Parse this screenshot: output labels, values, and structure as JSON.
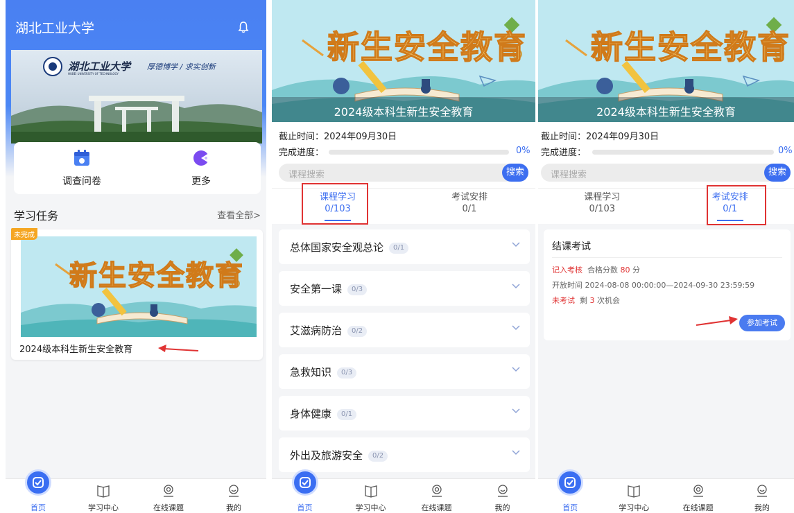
{
  "panel1": {
    "app_title": "湖北工业大学",
    "campus_motto": "厚德博学 / 求实创新",
    "campus_name": "湖北工业大学",
    "campus_name_en": "HUBEI UNIVERSITY OF TECHNOLOGY",
    "quick_actions": [
      {
        "label": "调查问卷",
        "icon": "calendar-icon"
      },
      {
        "label": "更多",
        "icon": "more-icon"
      }
    ],
    "section_title": "学习任务",
    "section_more": "查看全部>",
    "task": {
      "badge": "未完成",
      "banner_text": "新生安全教育",
      "name": "2024级本科生新生安全教育"
    }
  },
  "course_panel": {
    "banner_text": "新生安全教育",
    "banner_subtitle": "2024级本科生新生安全教育",
    "deadline": "截止时间：2024年09月30日",
    "progress_label": "完成进度：",
    "progress_percent": "0%",
    "progress_value": 0,
    "search_placeholder": "课程搜索",
    "search_button": "搜索",
    "tabs": [
      {
        "title": "课程学习",
        "count": "0/103"
      },
      {
        "title": "考试安排",
        "count": "0/1"
      }
    ],
    "courses": [
      {
        "name": "总体国家安全观总论",
        "count": "0/1"
      },
      {
        "name": "安全第一课",
        "count": "0/3"
      },
      {
        "name": "艾滋病防治",
        "count": "0/2"
      },
      {
        "name": "急救知识",
        "count": "0/3"
      },
      {
        "name": "身体健康",
        "count": "0/1"
      },
      {
        "name": "外出及旅游安全",
        "count": "0/2"
      }
    ]
  },
  "exam": {
    "title": "结课考试",
    "assess_tag": "记入考核",
    "pass_label": "合格分数",
    "pass_score": "80",
    "pass_unit": "分",
    "open_time": "开放时间 2024-08-08 00:00:00—2024-09-30 23:59:59",
    "status": "未考试",
    "remaining_pre": "剩",
    "remaining_count": "3",
    "remaining_post": "次机会",
    "join_button": "参加考试"
  },
  "nav": [
    {
      "label": "首页",
      "icon": "home-icon"
    },
    {
      "label": "学习中心",
      "icon": "book-icon"
    },
    {
      "label": "在线课题",
      "icon": "webcam-icon"
    },
    {
      "label": "我的",
      "icon": "user-icon"
    }
  ],
  "colors": {
    "primary": "#3c6ef0",
    "header_blue": "#4a80f2",
    "annotation_red": "#e03333",
    "badge_orange": "#f5a623"
  }
}
